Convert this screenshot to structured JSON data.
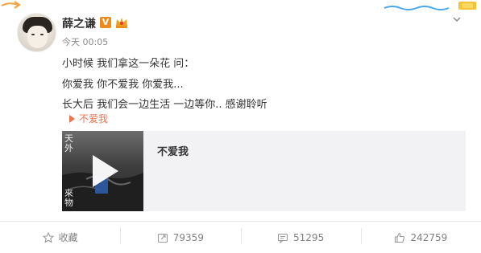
{
  "post": {
    "author": "薛之谦",
    "time": "今天 00:05",
    "lines": [
      "小时候 我们拿这一朵花 问：",
      "你爱我 你不爱我 你爱我...",
      "长大后 我们会一边生活 一边等你.. 感谢聆听"
    ],
    "music_link": "不爱我",
    "card_title": "不爱我",
    "cover_text_top": "天外",
    "cover_text_bottom": "來物"
  },
  "actions": {
    "favorite": "收藏",
    "repost_count": "79359",
    "comment_count": "51295",
    "like_count": "242759"
  },
  "colors": {
    "accent": "#eb7350",
    "verified": "#f08a1d"
  }
}
